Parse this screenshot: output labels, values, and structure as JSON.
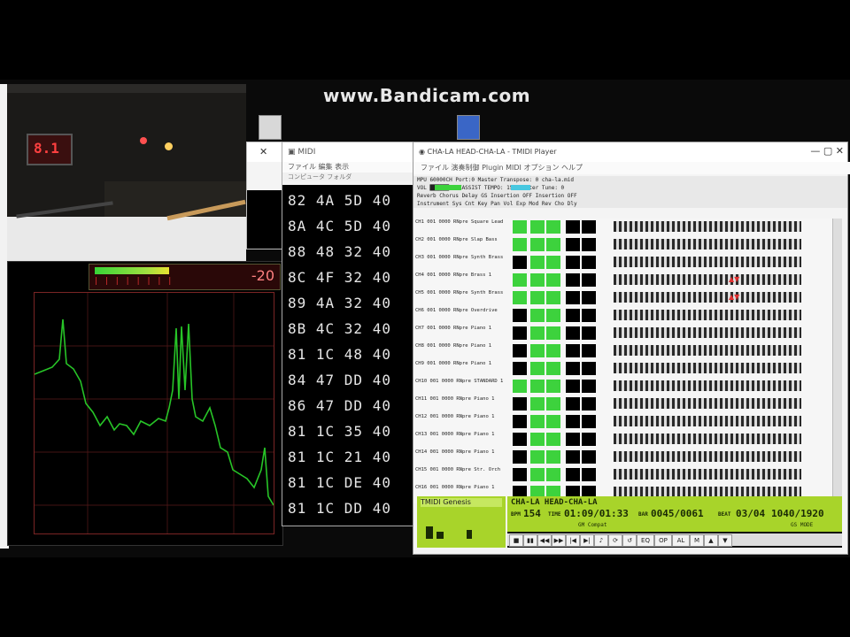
{
  "watermark": "www.Bandicam.com",
  "camera_window": {
    "led_value": "8.1"
  },
  "spectrum": {
    "level_db": "-20",
    "level_fraction": 0.42,
    "vu_ticks": "| | | | | | | |"
  },
  "hex_window": {
    "title": "MIDI",
    "menu": "ファイル  編集  表示",
    "toolbar": "コンピュータ  フォルダ",
    "lines": [
      "82 4A 5D 40",
      "8A 4C 5D 40",
      "88 48 32 40",
      "8C 4F 32 40",
      "89 4A 32 40",
      "8B 4C 32 40",
      "81 1C 48 40",
      "84 47 DD 40",
      "86 47 DD 40",
      "81 1C 35 40",
      "81 1C 21 40",
      "81 1C DE 40",
      "81 1C DD 40"
    ]
  },
  "tracker": {
    "title": "CHA-LA HEAD-CHA-LA - TMIDI Player",
    "title_buttons": "—  ▢  ✕",
    "menu": "ファイル  演奏制御  Plugin  MIDI  オプション  ヘルプ",
    "info_lines": [
      "MPU 60000CH Port:0   Master  Transpose: 0  cha-la.mid",
      "VOL ██████  MAXASSIST   TEMPO: 154   Master  Tune: 0",
      "Reverb  Chorus   Delay   GS Insertion  OFF  Insertion  OFF",
      "Instrument  Sys  Cnt  Key  Pan  Vol  Exp  Mod  Rev  Cho  Dly"
    ],
    "channels": [
      {
        "ch": "CH1",
        "name": "Square Lead"
      },
      {
        "ch": "CH2",
        "name": "Slap Bass"
      },
      {
        "ch": "CH3",
        "name": "Synth Brass"
      },
      {
        "ch": "CH4",
        "name": "Brass 1"
      },
      {
        "ch": "CH5",
        "name": "Synth Brass"
      },
      {
        "ch": "CH6",
        "name": "Overdrive"
      },
      {
        "ch": "CH7",
        "name": "Piano 1"
      },
      {
        "ch": "CH8",
        "name": "Piano 1"
      },
      {
        "ch": "CH9",
        "name": "Piano 1"
      },
      {
        "ch": "CH10",
        "name": "STANDARD 1"
      },
      {
        "ch": "CH11",
        "name": "Piano 1"
      },
      {
        "ch": "CH12",
        "name": "Piano 1"
      },
      {
        "ch": "CH13",
        "name": "Piano 1"
      },
      {
        "ch": "CH14",
        "name": "Piano 1"
      },
      {
        "ch": "CH15",
        "name": "Str. Orch"
      },
      {
        "ch": "CH16",
        "name": "Piano 1"
      }
    ],
    "gs_title": "TMIDI Genesis",
    "song_title": "CHA-LA HEAD-CHA-LA",
    "bpm_label": "BPM",
    "bpm": "154",
    "time_label": "TIME",
    "time": "01:09/01:33",
    "bar_label": "BAR",
    "bar": "0045/0061",
    "beat_label": "BEAT",
    "beat": "03/04",
    "tick": "1040/1920",
    "sub_left": "GM Compat",
    "sub_right": "GS MODE",
    "transport": [
      "■",
      "▮▮",
      "◀◀",
      "▶▶",
      "|◀",
      "▶|",
      "♪",
      "⟳",
      "↺",
      "EQ",
      "OP",
      "AL",
      "M",
      "▲",
      "▼"
    ]
  },
  "colors": {
    "lcd_green": "#a8d42a",
    "meter_green": "#3dd23d",
    "spectrum_line": "#27c427"
  }
}
